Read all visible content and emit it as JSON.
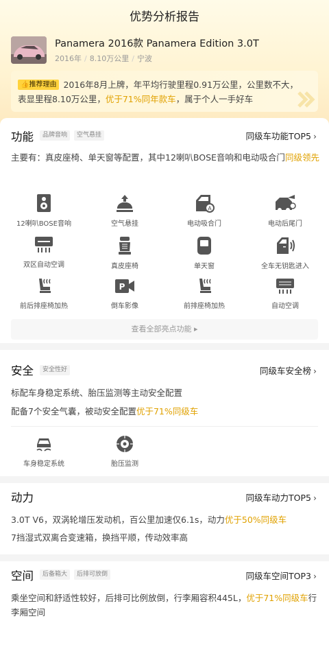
{
  "page": {
    "title": "优势分析报告"
  },
  "car": {
    "name": "Panamera 2016款 Panamera Edition 3.0T",
    "year": "2016年",
    "mileage": "8.10万公里",
    "city": "宁波"
  },
  "reason": {
    "badge": "推荐理由",
    "text_before": "2016年8月上牌，年平均行驶里程0.91万公里，公里数不大，表显里程8.10万公里，",
    "highlight": "优于71%同年款车",
    "text_after": "，属于个人一手好车"
  },
  "function": {
    "title": "功能",
    "tags": [
      "品牌音响",
      "空气悬挂"
    ],
    "rank_link": "同级车功能TOP5",
    "desc_before": "主要有：真皮座椅、单天窗等配置，其中12喇叭BOSE音响和电动吸合门",
    "desc_highlight": "同级领先",
    "features": [
      {
        "label": "12喇叭BOSE音响",
        "icon": "speaker-icon"
      },
      {
        "label": "空气悬挂",
        "icon": "air-suspension-icon"
      },
      {
        "label": "电动吸合门",
        "icon": "power-door-icon"
      },
      {
        "label": "电动后尾门",
        "icon": "power-tailgate-icon"
      },
      {
        "label": "双区自动空调",
        "icon": "dual-zone-ac-icon"
      },
      {
        "label": "真皮座椅",
        "icon": "leather-seat-icon"
      },
      {
        "label": "单天窗",
        "icon": "sunroof-icon"
      },
      {
        "label": "全车无钥匙进入",
        "icon": "keyless-entry-icon"
      },
      {
        "label": "前后排座椅加热",
        "icon": "seat-heat-icon"
      },
      {
        "label": "倒车影像",
        "icon": "reverse-camera-icon"
      },
      {
        "label": "前排座椅加热",
        "icon": "front-seat-heat-icon"
      },
      {
        "label": "自动空调",
        "icon": "auto-ac-icon"
      }
    ],
    "more_label": "查看全部亮点功能"
  },
  "safety": {
    "title": "安全",
    "tags": [
      "安全性好"
    ],
    "rank_link": "同级车安全榜",
    "line1": "标配车身稳定系统、胎压监测等主动安全配置",
    "line2_before": "配备7个安全气囊，被动安全配置",
    "line2_highlight": "优于71%同级车",
    "features": [
      {
        "label": "车身稳定系统",
        "icon": "stability-control-icon"
      },
      {
        "label": "胎压监测",
        "icon": "tire-pressure-icon"
      }
    ]
  },
  "power": {
    "title": "动力",
    "rank_link": "同级车动力TOP5",
    "line1_before": "3.0T V6，双涡轮增压发动机，百公里加速仅6.1s，动力",
    "line1_highlight": "优于50%同级车",
    "line2": "7挡湿式双离合变速箱，换挡平顺，传动效率高"
  },
  "space": {
    "title": "空间",
    "tags": [
      "后备箱大",
      "后排可放倒"
    ],
    "rank_link": "同级车空间TOP3",
    "desc_before": "乘坐空间和舒适性较好，后排可比例放倒，行李厢容积445L，",
    "desc_highlight": "优于71%同级车",
    "desc_after": "行李厢空间"
  },
  "colors": {
    "accent_gold": "#e0a100",
    "badge_yellow": "#ffd33d",
    "chevron": "▸"
  }
}
